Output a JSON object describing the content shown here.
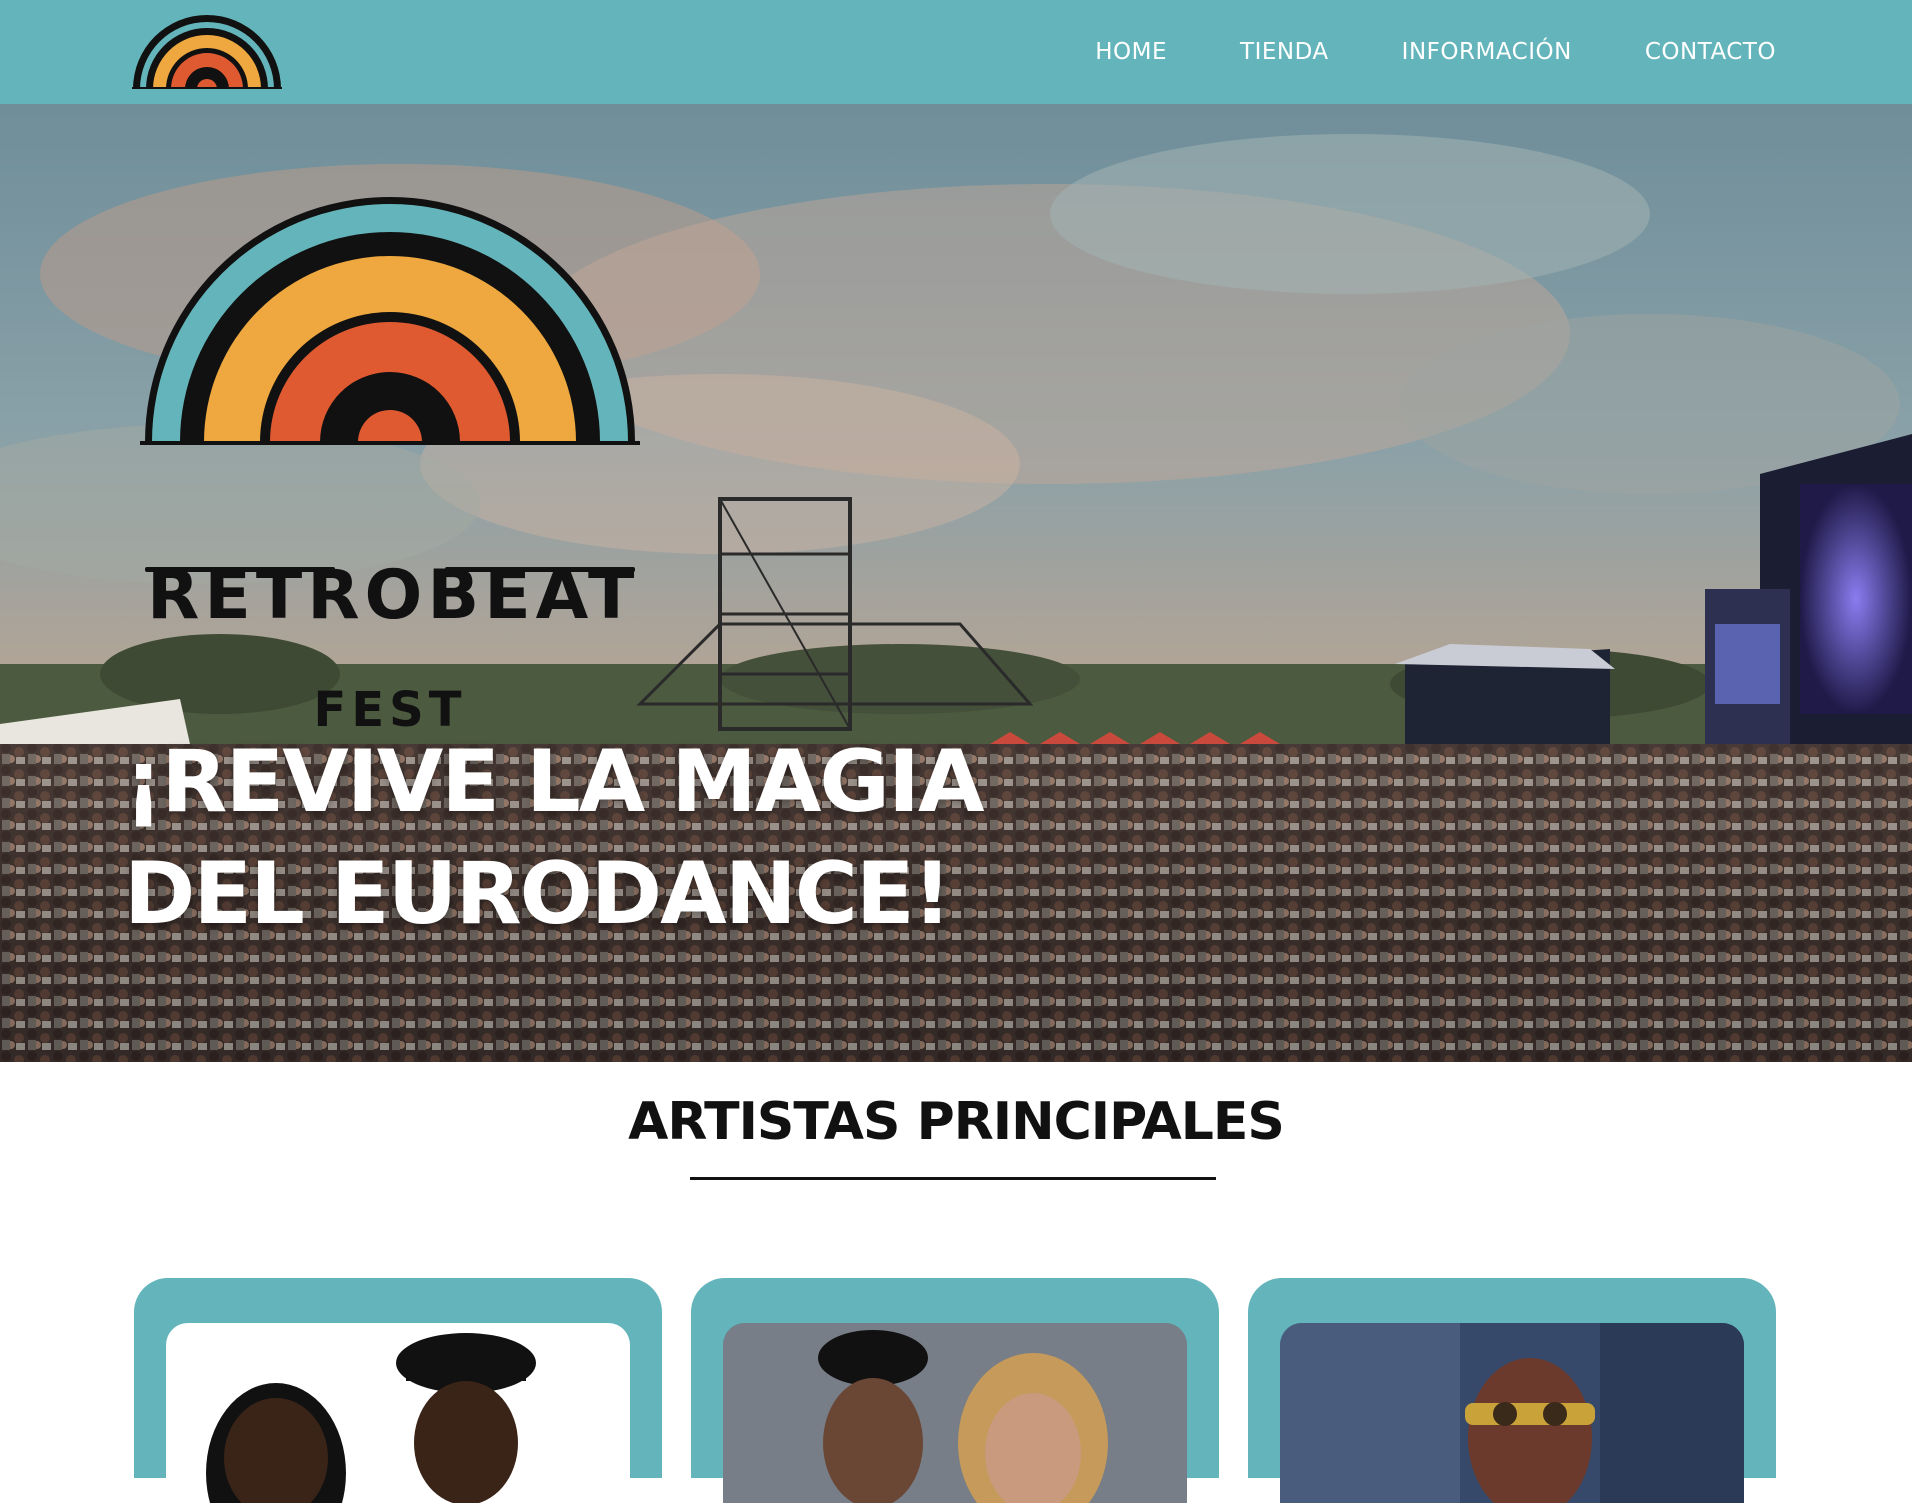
{
  "nav": {
    "logo_icon": "retrobeat-rainbow-logo",
    "links": [
      "HOME",
      "TIENDA",
      "INFORMACIÓN",
      "CONTACTO"
    ]
  },
  "hero": {
    "logo": {
      "icon": "retrobeat-rainbow-logo",
      "wordmark": "RETROBEAT",
      "subtitle": "FEST"
    },
    "headline_line1": "¡REVIVE LA MAGIA",
    "headline_line2": "DEL EURODANCE!"
  },
  "artists_section": {
    "title": "ARTISTAS PRINCIPALES",
    "cards": [
      {
        "photo_icon": "artist-duo-photo"
      },
      {
        "photo_icon": "artist-duo-photo"
      },
      {
        "photo_icon": "artist-singer-photo"
      }
    ]
  },
  "colors": {
    "teal": "#64b5bb",
    "orange_yellow": "#eea83f",
    "orange_red": "#df5a31",
    "black": "#111111",
    "white": "#ffffff"
  }
}
